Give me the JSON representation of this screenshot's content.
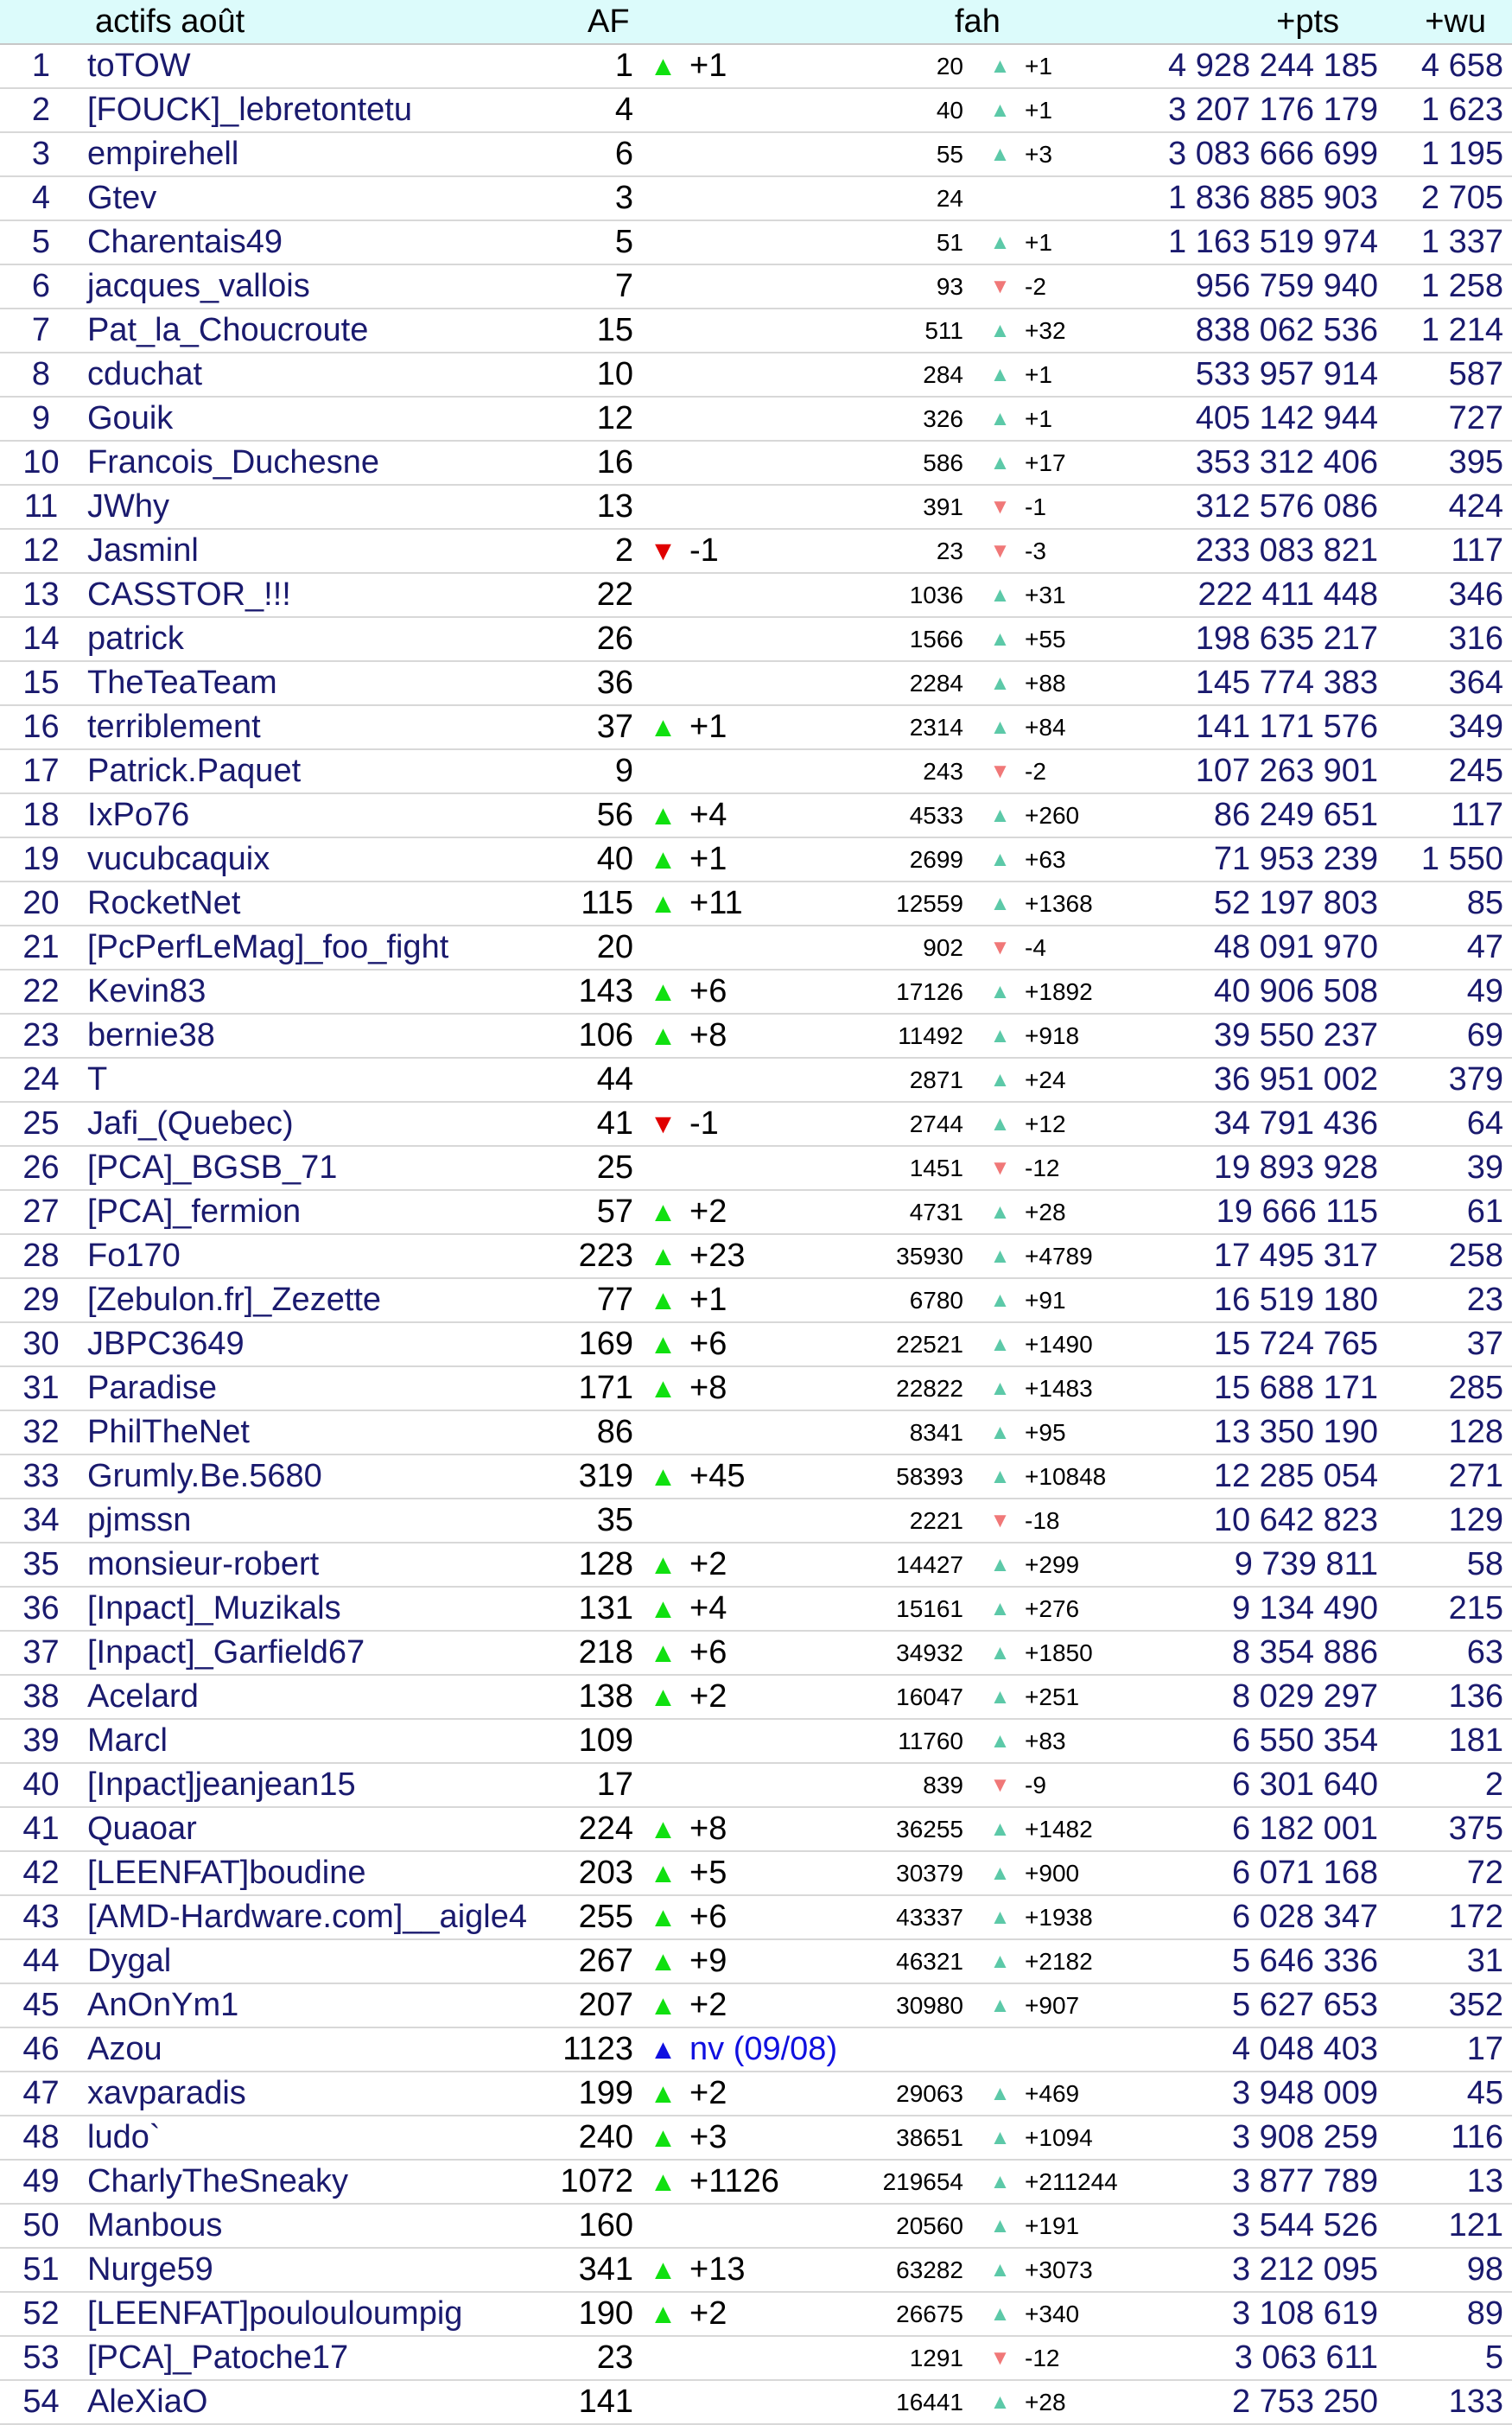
{
  "header": {
    "name_col": "actifs août",
    "af_col": "AF",
    "fah_col": "fah",
    "pts_col": "+pts",
    "wu_col": "+wu"
  },
  "colors": {
    "header_bg": "#dcfbfb",
    "name_text": "#1a1a6e",
    "arrow_up_big": "#10e010",
    "arrow_down_big": "#e00000",
    "arrow_new": "#1010e0",
    "arrow_up_small": "#5cc9a8",
    "arrow_down_small": "#f07878"
  },
  "rows": [
    {
      "rank": "1",
      "name": "toTOW",
      "af": "1",
      "af_arrow": "up",
      "af_delta": "+1",
      "fah": "20",
      "fah_arrow": "up",
      "fah_delta": "+1",
      "pts": "4 928 244 185",
      "wu": "4 658"
    },
    {
      "rank": "2",
      "name": "[FOUCK]_lebretontetu",
      "af": "4",
      "af_arrow": "",
      "af_delta": "",
      "fah": "40",
      "fah_arrow": "up",
      "fah_delta": "+1",
      "pts": "3 207 176 179",
      "wu": "1 623"
    },
    {
      "rank": "3",
      "name": "empirehell",
      "af": "6",
      "af_arrow": "",
      "af_delta": "",
      "fah": "55",
      "fah_arrow": "up",
      "fah_delta": "+3",
      "pts": "3 083 666 699",
      "wu": "1 195"
    },
    {
      "rank": "4",
      "name": "Gtev",
      "af": "3",
      "af_arrow": "",
      "af_delta": "",
      "fah": "24",
      "fah_arrow": "",
      "fah_delta": "",
      "pts": "1 836 885 903",
      "wu": "2 705"
    },
    {
      "rank": "5",
      "name": "Charentais49",
      "af": "5",
      "af_arrow": "",
      "af_delta": "",
      "fah": "51",
      "fah_arrow": "up",
      "fah_delta": "+1",
      "pts": "1 163 519 974",
      "wu": "1 337"
    },
    {
      "rank": "6",
      "name": "jacques_vallois",
      "af": "7",
      "af_arrow": "",
      "af_delta": "",
      "fah": "93",
      "fah_arrow": "down",
      "fah_delta": "-2",
      "pts": "956 759 940",
      "wu": "1 258"
    },
    {
      "rank": "7",
      "name": "Pat_la_Choucroute",
      "af": "15",
      "af_arrow": "",
      "af_delta": "",
      "fah": "511",
      "fah_arrow": "up",
      "fah_delta": "+32",
      "pts": "838 062 536",
      "wu": "1 214"
    },
    {
      "rank": "8",
      "name": "cduchat",
      "af": "10",
      "af_arrow": "",
      "af_delta": "",
      "fah": "284",
      "fah_arrow": "up",
      "fah_delta": "+1",
      "pts": "533 957 914",
      "wu": "587"
    },
    {
      "rank": "9",
      "name": "Gouik",
      "af": "12",
      "af_arrow": "",
      "af_delta": "",
      "fah": "326",
      "fah_arrow": "up",
      "fah_delta": "+1",
      "pts": "405 142 944",
      "wu": "727"
    },
    {
      "rank": "10",
      "name": "Francois_Duchesne",
      "af": "16",
      "af_arrow": "",
      "af_delta": "",
      "fah": "586",
      "fah_arrow": "up",
      "fah_delta": "+17",
      "pts": "353 312 406",
      "wu": "395"
    },
    {
      "rank": "11",
      "name": "JWhy",
      "af": "13",
      "af_arrow": "",
      "af_delta": "",
      "fah": "391",
      "fah_arrow": "down",
      "fah_delta": "-1",
      "pts": "312 576 086",
      "wu": "424"
    },
    {
      "rank": "12",
      "name": "Jasminl",
      "af": "2",
      "af_arrow": "down",
      "af_delta": "-1",
      "fah": "23",
      "fah_arrow": "down",
      "fah_delta": "-3",
      "pts": "233 083 821",
      "wu": "117"
    },
    {
      "rank": "13",
      "name": "CASSTOR_!!!",
      "af": "22",
      "af_arrow": "",
      "af_delta": "",
      "fah": "1036",
      "fah_arrow": "up",
      "fah_delta": "+31",
      "pts": "222 411 448",
      "wu": "346"
    },
    {
      "rank": "14",
      "name": "patrick",
      "af": "26",
      "af_arrow": "",
      "af_delta": "",
      "fah": "1566",
      "fah_arrow": "up",
      "fah_delta": "+55",
      "pts": "198 635 217",
      "wu": "316"
    },
    {
      "rank": "15",
      "name": "TheTeaTeam",
      "af": "36",
      "af_arrow": "",
      "af_delta": "",
      "fah": "2284",
      "fah_arrow": "up",
      "fah_delta": "+88",
      "pts": "145 774 383",
      "wu": "364"
    },
    {
      "rank": "16",
      "name": "terriblement",
      "af": "37",
      "af_arrow": "up",
      "af_delta": "+1",
      "fah": "2314",
      "fah_arrow": "up",
      "fah_delta": "+84",
      "pts": "141 171 576",
      "wu": "349"
    },
    {
      "rank": "17",
      "name": "Patrick.Paquet",
      "af": "9",
      "af_arrow": "",
      "af_delta": "",
      "fah": "243",
      "fah_arrow": "down",
      "fah_delta": "-2",
      "pts": "107 263 901",
      "wu": "245"
    },
    {
      "rank": "18",
      "name": "IxPo76",
      "af": "56",
      "af_arrow": "up",
      "af_delta": "+4",
      "fah": "4533",
      "fah_arrow": "up",
      "fah_delta": "+260",
      "pts": "86 249 651",
      "wu": "117"
    },
    {
      "rank": "19",
      "name": "vucubcaquix",
      "af": "40",
      "af_arrow": "up",
      "af_delta": "+1",
      "fah": "2699",
      "fah_arrow": "up",
      "fah_delta": "+63",
      "pts": "71 953 239",
      "wu": "1 550"
    },
    {
      "rank": "20",
      "name": "RocketNet",
      "af": "115",
      "af_arrow": "up",
      "af_delta": "+11",
      "fah": "12559",
      "fah_arrow": "up",
      "fah_delta": "+1368",
      "pts": "52 197 803",
      "wu": "85"
    },
    {
      "rank": "21",
      "name": "[PcPerfLeMag]_foo_fight",
      "af": "20",
      "af_arrow": "",
      "af_delta": "",
      "fah": "902",
      "fah_arrow": "down",
      "fah_delta": "-4",
      "pts": "48 091 970",
      "wu": "47"
    },
    {
      "rank": "22",
      "name": "Kevin83",
      "af": "143",
      "af_arrow": "up",
      "af_delta": "+6",
      "fah": "17126",
      "fah_arrow": "up",
      "fah_delta": "+1892",
      "pts": "40 906 508",
      "wu": "49"
    },
    {
      "rank": "23",
      "name": "bernie38",
      "af": "106",
      "af_arrow": "up",
      "af_delta": "+8",
      "fah": "11492",
      "fah_arrow": "up",
      "fah_delta": "+918",
      "pts": "39 550 237",
      "wu": "69"
    },
    {
      "rank": "24",
      "name": "T",
      "af": "44",
      "af_arrow": "",
      "af_delta": "",
      "fah": "2871",
      "fah_arrow": "up",
      "fah_delta": "+24",
      "pts": "36 951 002",
      "wu": "379"
    },
    {
      "rank": "25",
      "name": "Jafi_(Quebec)",
      "af": "41",
      "af_arrow": "down",
      "af_delta": "-1",
      "fah": "2744",
      "fah_arrow": "up",
      "fah_delta": "+12",
      "pts": "34 791 436",
      "wu": "64"
    },
    {
      "rank": "26",
      "name": "[PCA]_BGSB_71",
      "af": "25",
      "af_arrow": "",
      "af_delta": "",
      "fah": "1451",
      "fah_arrow": "down",
      "fah_delta": "-12",
      "pts": "19 893 928",
      "wu": "39"
    },
    {
      "rank": "27",
      "name": "[PCA]_fermion",
      "af": "57",
      "af_arrow": "up",
      "af_delta": "+2",
      "fah": "4731",
      "fah_arrow": "up",
      "fah_delta": "+28",
      "pts": "19 666 115",
      "wu": "61"
    },
    {
      "rank": "28",
      "name": "Fo170",
      "af": "223",
      "af_arrow": "up",
      "af_delta": "+23",
      "fah": "35930",
      "fah_arrow": "up",
      "fah_delta": "+4789",
      "pts": "17 495 317",
      "wu": "258"
    },
    {
      "rank": "29",
      "name": "[Zebulon.fr]_Zezette",
      "af": "77",
      "af_arrow": "up",
      "af_delta": "+1",
      "fah": "6780",
      "fah_arrow": "up",
      "fah_delta": "+91",
      "pts": "16 519 180",
      "wu": "23"
    },
    {
      "rank": "30",
      "name": "JBPC3649",
      "af": "169",
      "af_arrow": "up",
      "af_delta": "+6",
      "fah": "22521",
      "fah_arrow": "up",
      "fah_delta": "+1490",
      "pts": "15 724 765",
      "wu": "37"
    },
    {
      "rank": "31",
      "name": "Paradise",
      "af": "171",
      "af_arrow": "up",
      "af_delta": "+8",
      "fah": "22822",
      "fah_arrow": "up",
      "fah_delta": "+1483",
      "pts": "15 688 171",
      "wu": "285"
    },
    {
      "rank": "32",
      "name": "PhilTheNet",
      "af": "86",
      "af_arrow": "",
      "af_delta": "",
      "fah": "8341",
      "fah_arrow": "up",
      "fah_delta": "+95",
      "pts": "13 350 190",
      "wu": "128"
    },
    {
      "rank": "33",
      "name": "Grumly.Be.5680",
      "af": "319",
      "af_arrow": "up",
      "af_delta": "+45",
      "fah": "58393",
      "fah_arrow": "up",
      "fah_delta": "+10848",
      "pts": "12 285 054",
      "wu": "271"
    },
    {
      "rank": "34",
      "name": "pjmssn",
      "af": "35",
      "af_arrow": "",
      "af_delta": "",
      "fah": "2221",
      "fah_arrow": "down",
      "fah_delta": "-18",
      "pts": "10 642 823",
      "wu": "129"
    },
    {
      "rank": "35",
      "name": "monsieur-robert",
      "af": "128",
      "af_arrow": "up",
      "af_delta": "+2",
      "fah": "14427",
      "fah_arrow": "up",
      "fah_delta": "+299",
      "pts": "9 739 811",
      "wu": "58"
    },
    {
      "rank": "36",
      "name": "[Inpact]_Muzikals",
      "af": "131",
      "af_arrow": "up",
      "af_delta": "+4",
      "fah": "15161",
      "fah_arrow": "up",
      "fah_delta": "+276",
      "pts": "9 134 490",
      "wu": "215"
    },
    {
      "rank": "37",
      "name": "[Inpact]_Garfield67",
      "af": "218",
      "af_arrow": "up",
      "af_delta": "+6",
      "fah": "34932",
      "fah_arrow": "up",
      "fah_delta": "+1850",
      "pts": "8 354 886",
      "wu": "63"
    },
    {
      "rank": "38",
      "name": "Acelard",
      "af": "138",
      "af_arrow": "up",
      "af_delta": "+2",
      "fah": "16047",
      "fah_arrow": "up",
      "fah_delta": "+251",
      "pts": "8 029 297",
      "wu": "136"
    },
    {
      "rank": "39",
      "name": "Marcl",
      "af": "109",
      "af_arrow": "",
      "af_delta": "",
      "fah": "11760",
      "fah_arrow": "up",
      "fah_delta": "+83",
      "pts": "6 550 354",
      "wu": "181"
    },
    {
      "rank": "40",
      "name": "[Inpact]jeanjean15",
      "af": "17",
      "af_arrow": "",
      "af_delta": "",
      "fah": "839",
      "fah_arrow": "down",
      "fah_delta": "-9",
      "pts": "6 301 640",
      "wu": "2"
    },
    {
      "rank": "41",
      "name": "Quaoar",
      "af": "224",
      "af_arrow": "up",
      "af_delta": "+8",
      "fah": "36255",
      "fah_arrow": "up",
      "fah_delta": "+1482",
      "pts": "6 182 001",
      "wu": "375"
    },
    {
      "rank": "42",
      "name": "[LEENFAT]boudine",
      "af": "203",
      "af_arrow": "up",
      "af_delta": "+5",
      "fah": "30379",
      "fah_arrow": "up",
      "fah_delta": "+900",
      "pts": "6 071 168",
      "wu": "72"
    },
    {
      "rank": "43",
      "name": "[AMD-Hardware.com]__aigle4",
      "af": "255",
      "af_arrow": "up",
      "af_delta": "+6",
      "fah": "43337",
      "fah_arrow": "up",
      "fah_delta": "+1938",
      "pts": "6 028 347",
      "wu": "172"
    },
    {
      "rank": "44",
      "name": "Dygal",
      "af": "267",
      "af_arrow": "up",
      "af_delta": "+9",
      "fah": "46321",
      "fah_arrow": "up",
      "fah_delta": "+2182",
      "pts": "5 646 336",
      "wu": "31"
    },
    {
      "rank": "45",
      "name": "AnOnYm1",
      "af": "207",
      "af_arrow": "up",
      "af_delta": "+2",
      "fah": "30980",
      "fah_arrow": "up",
      "fah_delta": "+907",
      "pts": "5 627 653",
      "wu": "352"
    },
    {
      "rank": "46",
      "name": "Azou",
      "af": "1123",
      "af_arrow": "new",
      "af_delta": "nv (09/08)",
      "fah": "",
      "fah_arrow": "",
      "fah_delta": "",
      "pts": "4 048 403",
      "wu": "17"
    },
    {
      "rank": "47",
      "name": "xavparadis",
      "af": "199",
      "af_arrow": "up",
      "af_delta": "+2",
      "fah": "29063",
      "fah_arrow": "up",
      "fah_delta": "+469",
      "pts": "3 948 009",
      "wu": "45"
    },
    {
      "rank": "48",
      "name": "ludo`",
      "af": "240",
      "af_arrow": "up",
      "af_delta": "+3",
      "fah": "38651",
      "fah_arrow": "up",
      "fah_delta": "+1094",
      "pts": "3 908 259",
      "wu": "116"
    },
    {
      "rank": "49",
      "name": "CharlyTheSneaky",
      "af": "1072",
      "af_arrow": "up",
      "af_delta": "+1126",
      "fah": "219654",
      "fah_arrow": "up",
      "fah_delta": "+211244",
      "pts": "3 877 789",
      "wu": "13"
    },
    {
      "rank": "50",
      "name": "Manbous",
      "af": "160",
      "af_arrow": "",
      "af_delta": "",
      "fah": "20560",
      "fah_arrow": "up",
      "fah_delta": "+191",
      "pts": "3 544 526",
      "wu": "121"
    },
    {
      "rank": "51",
      "name": "Nurge59",
      "af": "341",
      "af_arrow": "up",
      "af_delta": "+13",
      "fah": "63282",
      "fah_arrow": "up",
      "fah_delta": "+3073",
      "pts": "3 212 095",
      "wu": "98"
    },
    {
      "rank": "52",
      "name": "[LEENFAT]poulouloumpig",
      "af": "190",
      "af_arrow": "up",
      "af_delta": "+2",
      "fah": "26675",
      "fah_arrow": "up",
      "fah_delta": "+340",
      "pts": "3 108 619",
      "wu": "89"
    },
    {
      "rank": "53",
      "name": "[PCA]_Patoche17",
      "af": "23",
      "af_arrow": "",
      "af_delta": "",
      "fah": "1291",
      "fah_arrow": "down",
      "fah_delta": "-12",
      "pts": "3 063 611",
      "wu": "5"
    },
    {
      "rank": "54",
      "name": "AleXiaO",
      "af": "141",
      "af_arrow": "",
      "af_delta": "",
      "fah": "16441",
      "fah_arrow": "up",
      "fah_delta": "+28",
      "pts": "2 753 250",
      "wu": "133"
    }
  ]
}
